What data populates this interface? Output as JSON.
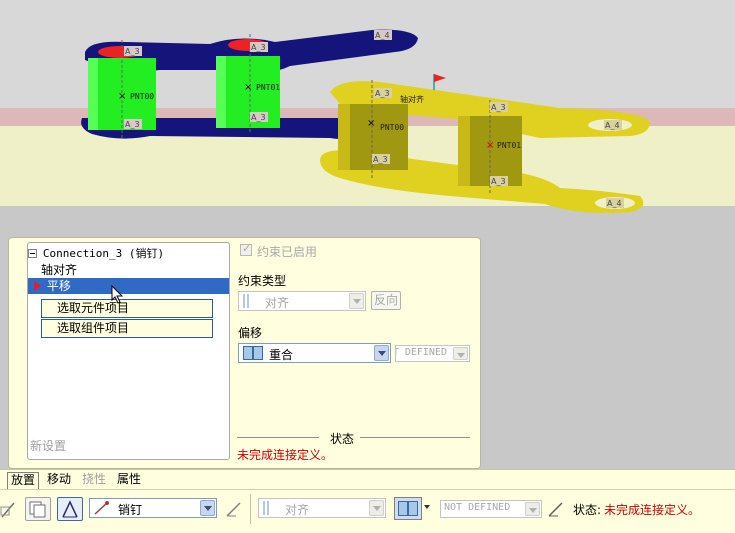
{
  "viewport": {
    "chain_left_labels": {
      "pnt_a": "PNT00",
      "pnt_b": "PNT01",
      "a3_top": "A_3",
      "a3_mid": "A_3",
      "a3_bottom": "A_3",
      "a3_b": "A_3",
      "a4_top": "A_4"
    },
    "chain_right_labels": {
      "pnt_a": "PNT00",
      "pnt_b": "PNT01",
      "a3_a": "A_3",
      "a3_b": "A_3",
      "a3_c": "A_3",
      "a3_d": "A_3",
      "a4_a": "A_4",
      "a4_b": "A_4",
      "axis_label": "轴对齐"
    }
  },
  "tree": {
    "root_label": "Connection_3 (销钉)",
    "items": [
      {
        "label": "轴对齐"
      },
      {
        "label": "平移"
      }
    ],
    "sub_items": [
      {
        "label": "选取元件项目"
      },
      {
        "label": "选取组件项目"
      }
    ],
    "new_set_label": "新设置"
  },
  "constraint": {
    "enabled_label": "约束已启用",
    "type_heading": "约束类型",
    "type_value": "对齐",
    "flip_label": "反向",
    "offset_heading": "偏移",
    "offset_value": "重合",
    "offset_amount": "NOT DEFINED"
  },
  "status": {
    "heading": "状态",
    "message": "未完成连接定义。"
  },
  "tabs": [
    "放置",
    "移动",
    "挠性",
    "属性"
  ],
  "toolbar": {
    "connection_type": "销钉",
    "constraint_value": "对齐",
    "offset_value": "NOT DEFINED",
    "status_prefix": "状态:",
    "status_message": "未完成连接定义。"
  },
  "colors": {
    "panel_bg": "#ffffe0",
    "selection": "#316ac5",
    "status_red": "#cc0000",
    "chain_blue": "#14147a",
    "chain_green": "#22ee22",
    "chain_yellow": "#e0d020"
  }
}
